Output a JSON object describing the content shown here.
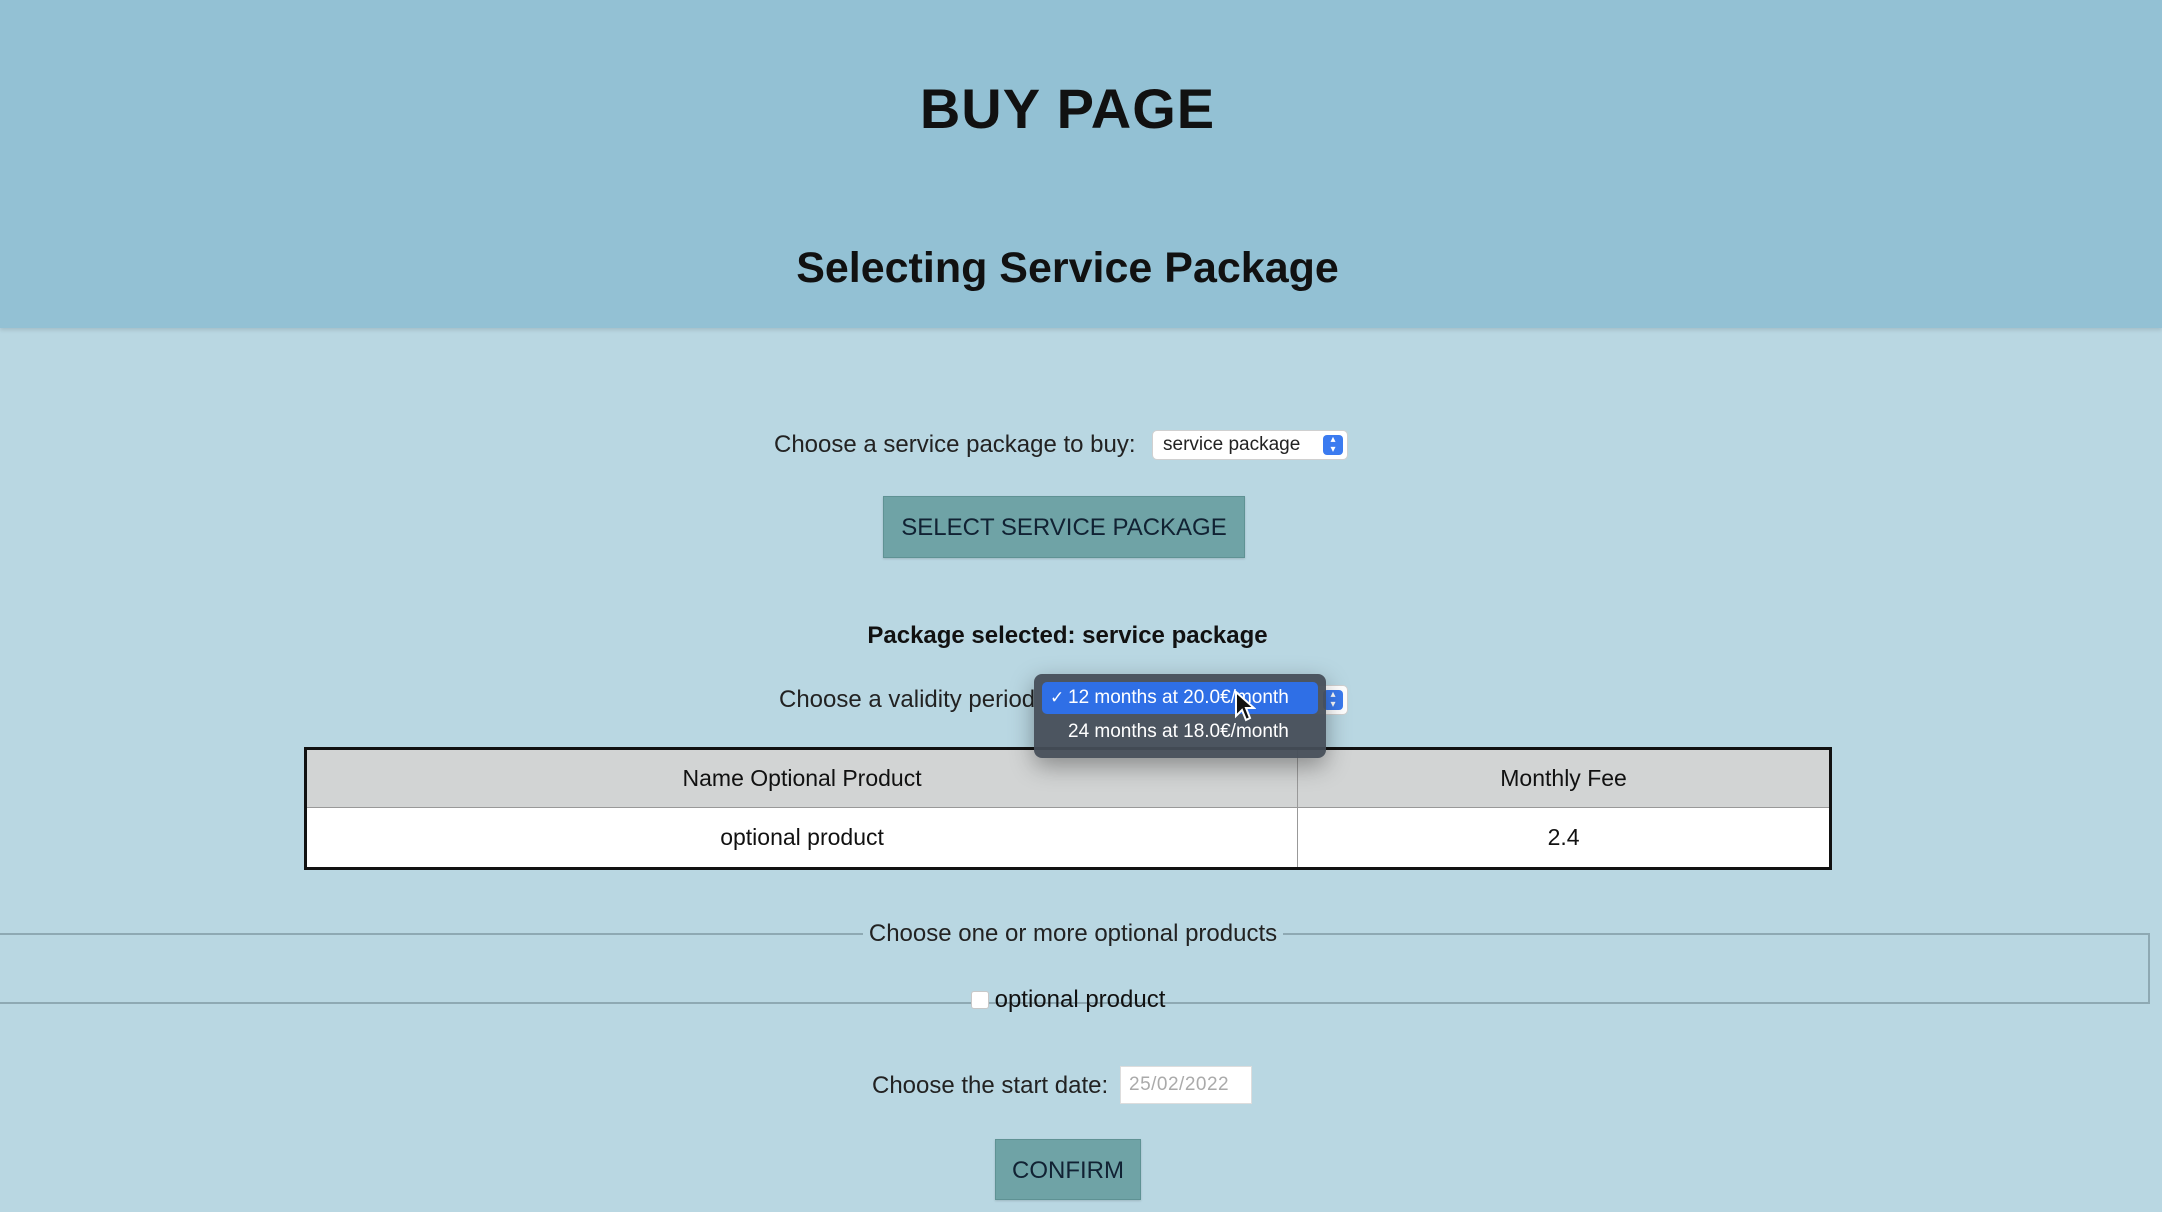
{
  "header": {
    "title": "BUY PAGE",
    "subtitle": "Selecting Service Package"
  },
  "package_select": {
    "label": "Choose a service package to buy:",
    "value": "service package",
    "button_label": "SELECT SERVICE PACKAGE"
  },
  "package_selected": "Package selected: service package",
  "validity": {
    "label": "Choose a validity period",
    "options": [
      "12 months at 20.0€/month",
      "24 months at 18.0€/month"
    ],
    "selected_index": 0
  },
  "table": {
    "headers": [
      "Name Optional Product",
      "Monthly Fee"
    ],
    "rows": [
      [
        "optional product",
        "2.4"
      ]
    ]
  },
  "optional_products": {
    "legend": "Choose one or more optional products",
    "items": [
      {
        "label": "optional product",
        "checked": false
      }
    ]
  },
  "start_date": {
    "label": "Choose the start date:",
    "value": "25/02/2022"
  },
  "confirm_label": "CONFIRM",
  "colors": {
    "header_bg": "#93c1d4",
    "body_bg": "#b9d7e2",
    "button_bg": "#6fa3a6",
    "dropdown_highlight": "#2f6fe6"
  }
}
